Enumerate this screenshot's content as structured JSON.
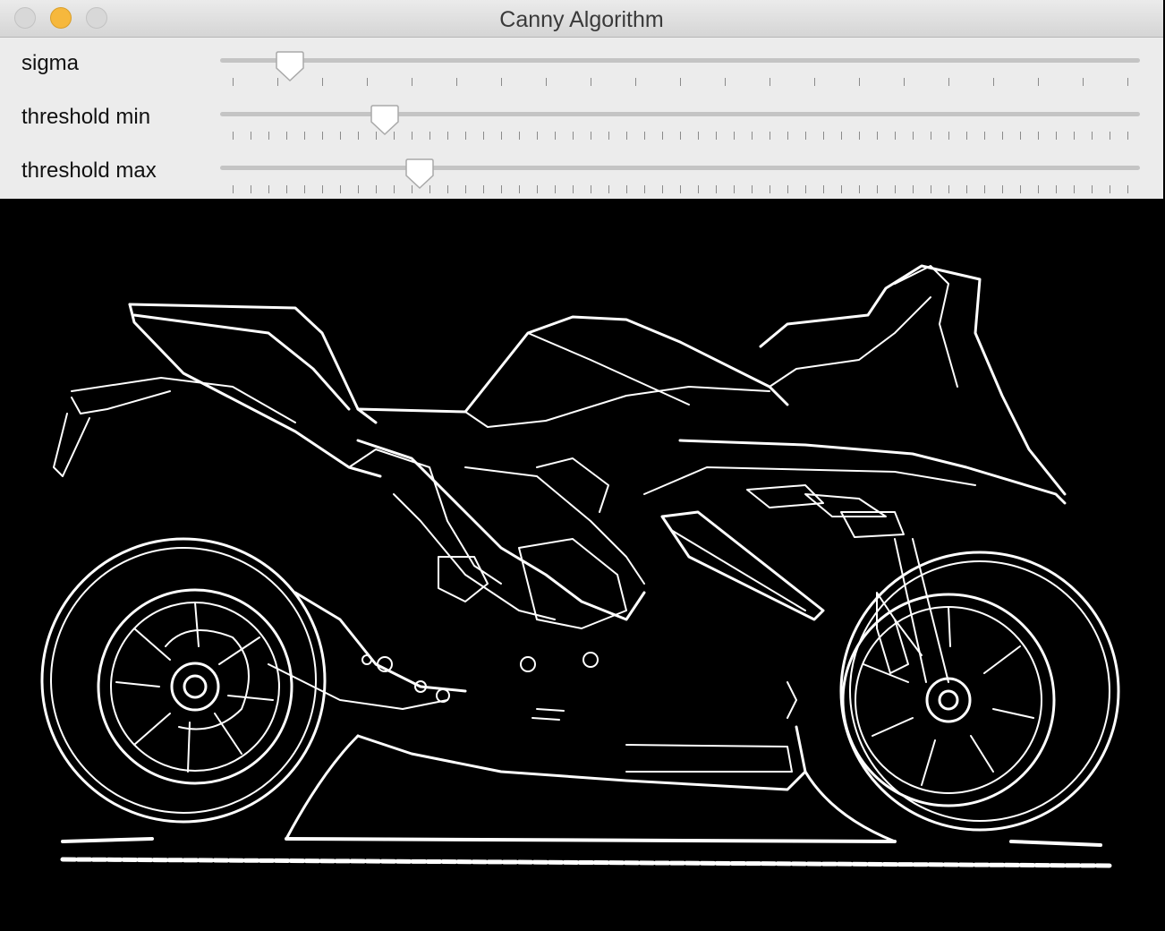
{
  "window": {
    "title": "Canny Algorithm",
    "traffic_lights": {
      "close": {
        "icon": "close-icon",
        "color": "#d8d8d8"
      },
      "minimize": {
        "icon": "minimize-icon",
        "color": "#f6b83d"
      },
      "zoom": {
        "icon": "zoom-icon",
        "color": "#d8d8d8"
      }
    }
  },
  "sliders": [
    {
      "label": "sigma",
      "value_fraction": 0.064,
      "tick_count": 21
    },
    {
      "label": "threshold min",
      "value_fraction": 0.17,
      "tick_count": 51
    },
    {
      "label": "threshold max",
      "value_fraction": 0.209,
      "tick_count": 51
    }
  ],
  "canvas": {
    "content": "canny edge-detection output of a sport motorcycle",
    "background": "#000000",
    "edge_color": "#ffffff"
  }
}
